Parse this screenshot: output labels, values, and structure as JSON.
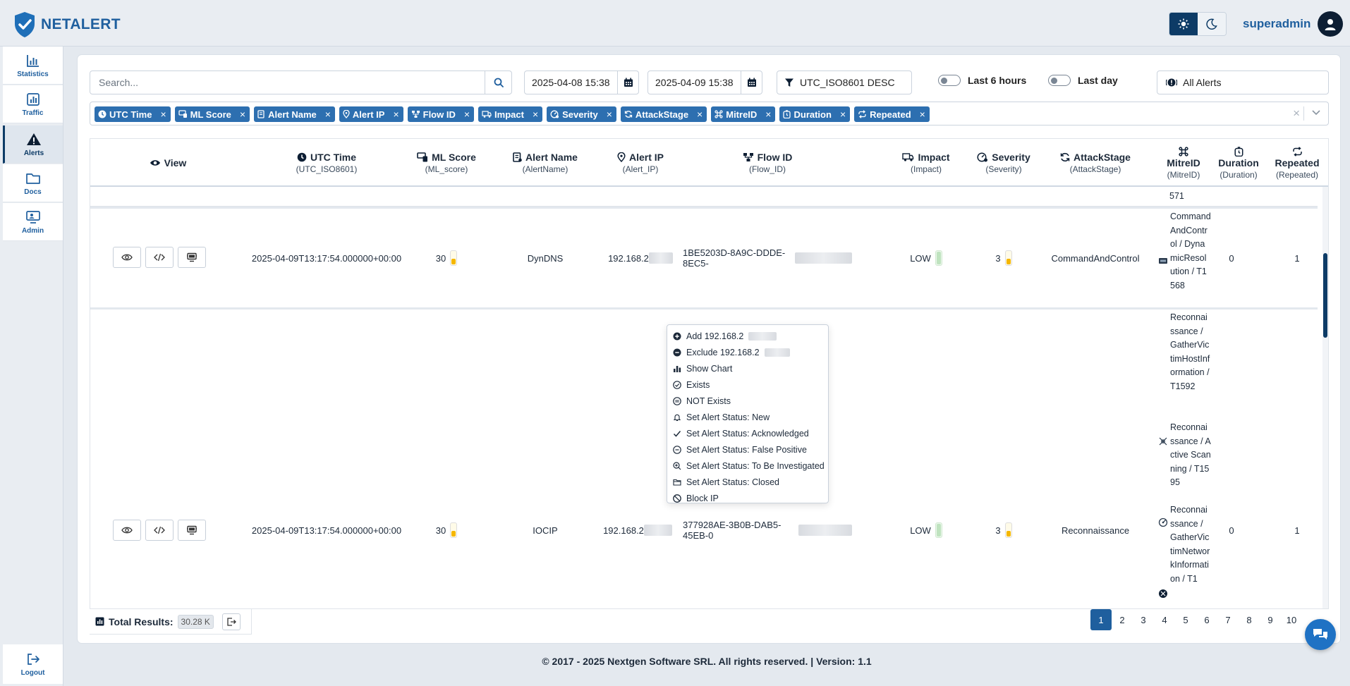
{
  "brand": {
    "name": "NETALERT"
  },
  "header": {
    "user": "superadmin"
  },
  "sidebar": {
    "items": [
      {
        "label": "Statistics"
      },
      {
        "label": "Traffic"
      },
      {
        "label": "Alerts"
      },
      {
        "label": "Docs"
      },
      {
        "label": "Admin"
      }
    ],
    "logout": "Logout"
  },
  "filters": {
    "search_placeholder": "Search...",
    "date_from": "2025-04-08 15:38",
    "date_to": "2025-04-09 15:38",
    "sort": "UTC_ISO8601 DESC",
    "last6h": "Last 6 hours",
    "lastday": "Last day",
    "alerts_scope": "All Alerts"
  },
  "chips": [
    "UTC Time",
    "ML Score",
    "Alert Name",
    "Alert IP",
    "Flow ID",
    "Impact",
    "Severity",
    "AttackStage",
    "MitreID",
    "Duration",
    "Repeated"
  ],
  "columns": {
    "view": {
      "title": "View"
    },
    "utc": {
      "title": "UTC Time",
      "sub": "(UTC_ISO8601)"
    },
    "ml": {
      "title": "ML Score",
      "sub": "(ML_score)"
    },
    "alertname": {
      "title": "Alert Name",
      "sub": "(AlertName)"
    },
    "alertip": {
      "title": "Alert IP",
      "sub": "(Alert_IP)"
    },
    "flow": {
      "title": "Flow ID",
      "sub": "(Flow_ID)"
    },
    "impact": {
      "title": "Impact",
      "sub": "(Impact)"
    },
    "severity": {
      "title": "Severity",
      "sub": "(Severity)"
    },
    "attack": {
      "title": "AttackStage",
      "sub": "(AttackStage)"
    },
    "mitre": {
      "title": "MitreID",
      "sub": "(MitreID)"
    },
    "duration": {
      "title": "Duration",
      "sub": "(Duration)"
    },
    "repeated": {
      "title": "Repeated",
      "sub": "(Repeated)"
    }
  },
  "top_fragment": "571",
  "rows": [
    {
      "utc": "2025-04-09T13:17:54.000000+00:00",
      "ml": "30",
      "alertname": "DynDNS",
      "alertip": "192.168.2",
      "flow": "1BE5203D-8A9C-DDDE-8EC5-",
      "impact": "LOW",
      "severity": "3",
      "attack": "CommandAndControl",
      "mitre": [
        "CommandAndControl / DynamicResolution / T1568"
      ],
      "duration": "0",
      "repeated": "1"
    },
    {
      "utc": "2025-04-09T13:17:54.000000+00:00",
      "ml": "30",
      "alertname": "IOCIP",
      "alertip": "192.168.2",
      "flow": "377928AE-3B0B-DAB5-45EB-0",
      "impact": "LOW",
      "severity": "3",
      "attack": "Reconnaissance",
      "mitre": [
        "Reconnaissance / GatherVictimHostInformation / T1592",
        "Reconnaissance / Active Scanning / T1595",
        "Reconnaissance / GatherVictimNetworkInformation / T1"
      ],
      "duration": "0",
      "repeated": "1"
    }
  ],
  "context_menu": [
    {
      "label": "Add 192.168.2",
      "icon": "plus-circle-icon"
    },
    {
      "label": "Exclude 192.168.2",
      "icon": "minus-circle-icon"
    },
    {
      "label": "Show Chart",
      "icon": "bar-chart-icon"
    },
    {
      "label": "Exists",
      "icon": "check-circle-icon"
    },
    {
      "label": "NOT Exists",
      "icon": "dash-circle-icon"
    },
    {
      "label": "Set Alert Status: New",
      "icon": "bell-icon"
    },
    {
      "label": "Set Alert Status: Acknowledged",
      "icon": "check-icon"
    },
    {
      "label": "Set Alert Status: False Positive",
      "icon": "minus-circle-outline-icon"
    },
    {
      "label": "Set Alert Status: To Be Investigated",
      "icon": "zoom-icon"
    },
    {
      "label": "Set Alert Status: Closed",
      "icon": "folder-icon"
    },
    {
      "label": "Block IP",
      "icon": "ban-icon"
    }
  ],
  "footer_bar": {
    "total_label": "Total Results:",
    "total_value": "30.28 K"
  },
  "pagination": [
    "1",
    "2",
    "3",
    "4",
    "5",
    "6",
    "7",
    "8",
    "9",
    "10"
  ],
  "copyright": "© 2017 - 2025 Nextgen Software SRL. All rights reserved. | Version: 1.1",
  "colors": {
    "primary": "#1f5f9e",
    "dark": "#0d3b66",
    "chip": "#2d6fb0",
    "warning": "#f5b700"
  }
}
